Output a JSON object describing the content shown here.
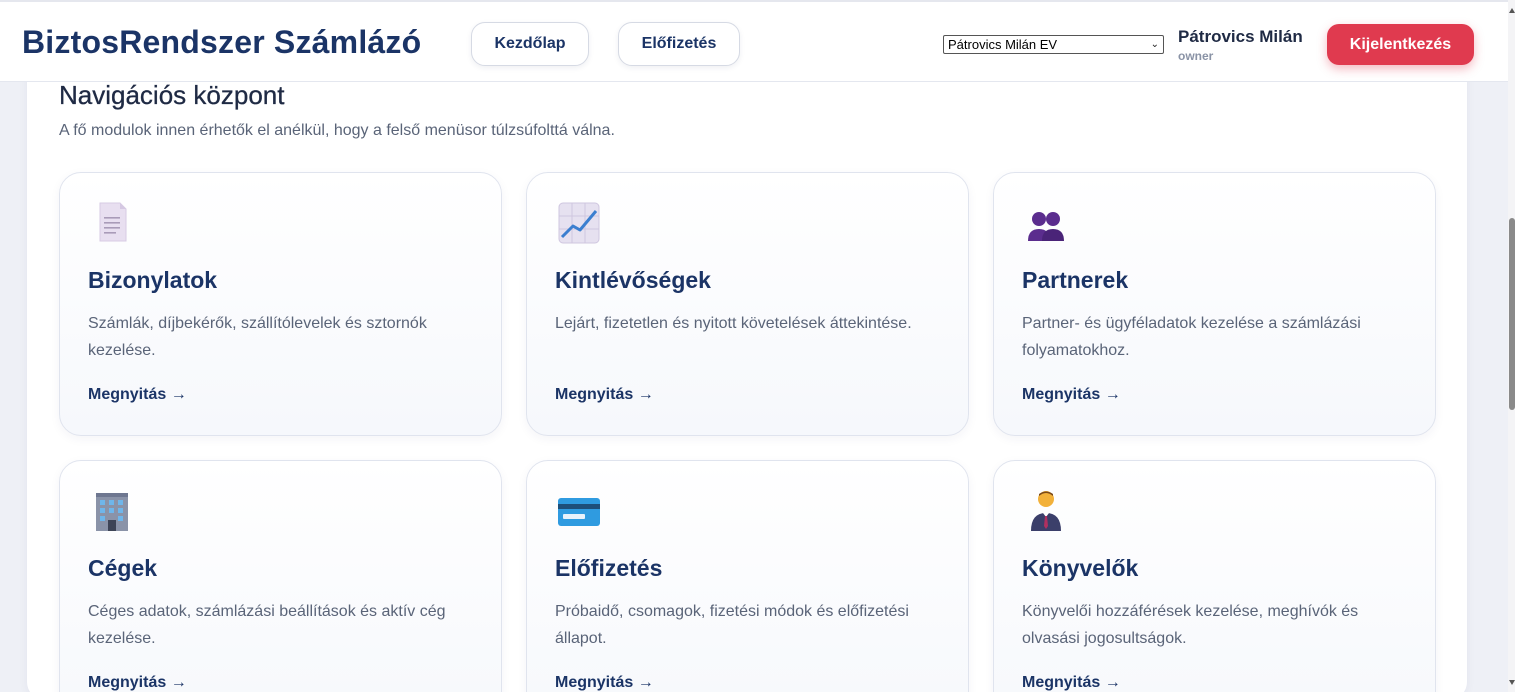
{
  "header": {
    "brand": "BiztosRendszer Számlázó",
    "nav": {
      "home_label": "Kezdőlap",
      "subscription_label": "Előfizetés"
    },
    "company_select": {
      "selected": "Pátrovics Milán EV"
    },
    "user": {
      "name": "Pátrovics Milán",
      "role": "owner"
    },
    "logout_label": "Kijelentkezés"
  },
  "main": {
    "title": "Navigációs központ",
    "subtitle": "A fő modulok innen érhetők el anélkül, hogy a felső menüsor túlzsúfolttá válna.",
    "cards": [
      {
        "icon": "document-icon",
        "title": "Bizonylatok",
        "description": "Számlák, díjbekérők, szállítólevelek és sztornók kezelése.",
        "link": "Megnyitás →"
      },
      {
        "icon": "chart-increasing-icon",
        "title": "Kintlévőségek",
        "description": "Lejárt, fizetetlen és nyitott követelések áttekintése.",
        "link": "Megnyitás →"
      },
      {
        "icon": "people-icon",
        "title": "Partnerek",
        "description": "Partner- és ügyféladatok kezelése a számlázási folyamatokhoz.",
        "link": "Megnyitás →"
      },
      {
        "icon": "office-building-icon",
        "title": "Cégek",
        "description": "Céges adatok, számlázási beállítások és aktív cég kezelése.",
        "link": "Megnyitás →"
      },
      {
        "icon": "credit-card-icon",
        "title": "Előfizetés",
        "description": "Próbaidő, csomagok, fizetési módok és előfizetési állapot.",
        "link": "Megnyitás →"
      },
      {
        "icon": "office-worker-icon",
        "title": "Könyvelők",
        "description": "Könyvelői hozzáférések kezelése, meghívók és olvasási jogosultságok.",
        "link": "Megnyitás →"
      }
    ]
  },
  "colors": {
    "brand": "#1b3466",
    "accent_danger": "#e03a4f",
    "muted_text": "#5a6478"
  }
}
